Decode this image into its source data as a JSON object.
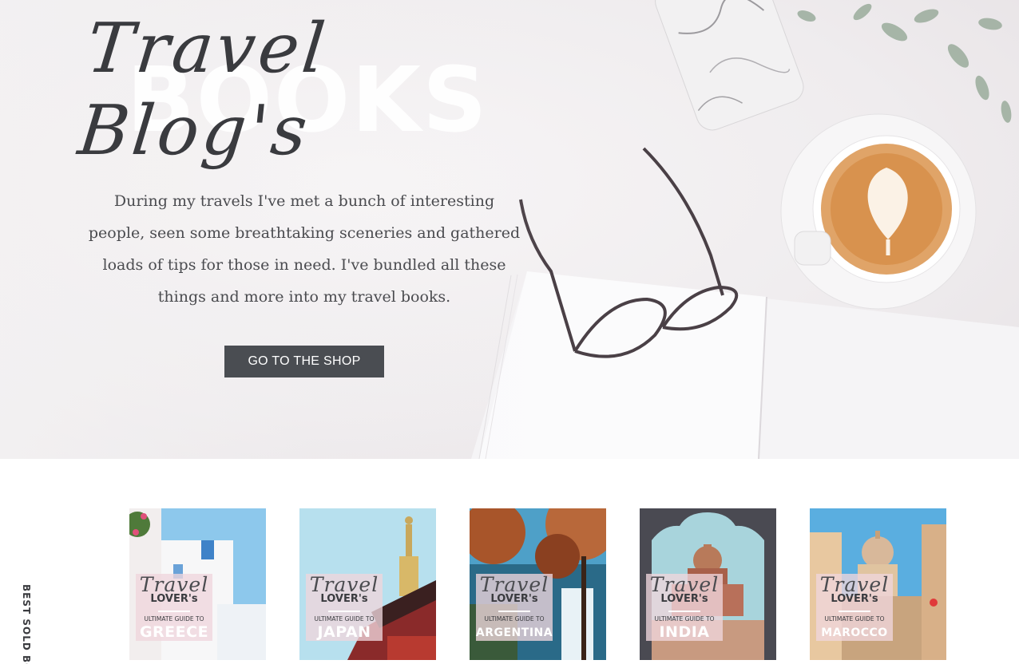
{
  "hero": {
    "title_script": "Travel Blog's",
    "title_big": "BOOKS",
    "intro": "During my travels I've met a bunch of interesting people, seen some breathtaking sceneries and gathered loads of tips for those in need. I've bundled all these things and more into my travel books.",
    "cta_label": "GO TO THE SHOP"
  },
  "books_section": {
    "side_label": "BEST SOLD BOOKS",
    "books": [
      {
        "script": "Travel",
        "lover": "LOVER's",
        "guide": "ULTIMATE GUIDE TO",
        "country": "GREECE"
      },
      {
        "script": "Travel",
        "lover": "LOVER's",
        "guide": "ULTIMATE GUIDE TO",
        "country": "JAPAN"
      },
      {
        "script": "Travel",
        "lover": "LOVER's",
        "guide": "ULTIMATE GUIDE TO",
        "country": "ARGENTINA"
      },
      {
        "script": "Travel",
        "lover": "LOVER's",
        "guide": "ULTIMATE GUIDE TO",
        "country": "INDIA"
      },
      {
        "script": "Travel",
        "lover": "LOVER's",
        "guide": "ULTIMATE GUIDE TO",
        "country": "MAROCCO"
      }
    ]
  },
  "colors": {
    "button_bg": "#4a4d52",
    "text_dark": "#3a3b3f",
    "label_pink": "#f0d6dc"
  }
}
